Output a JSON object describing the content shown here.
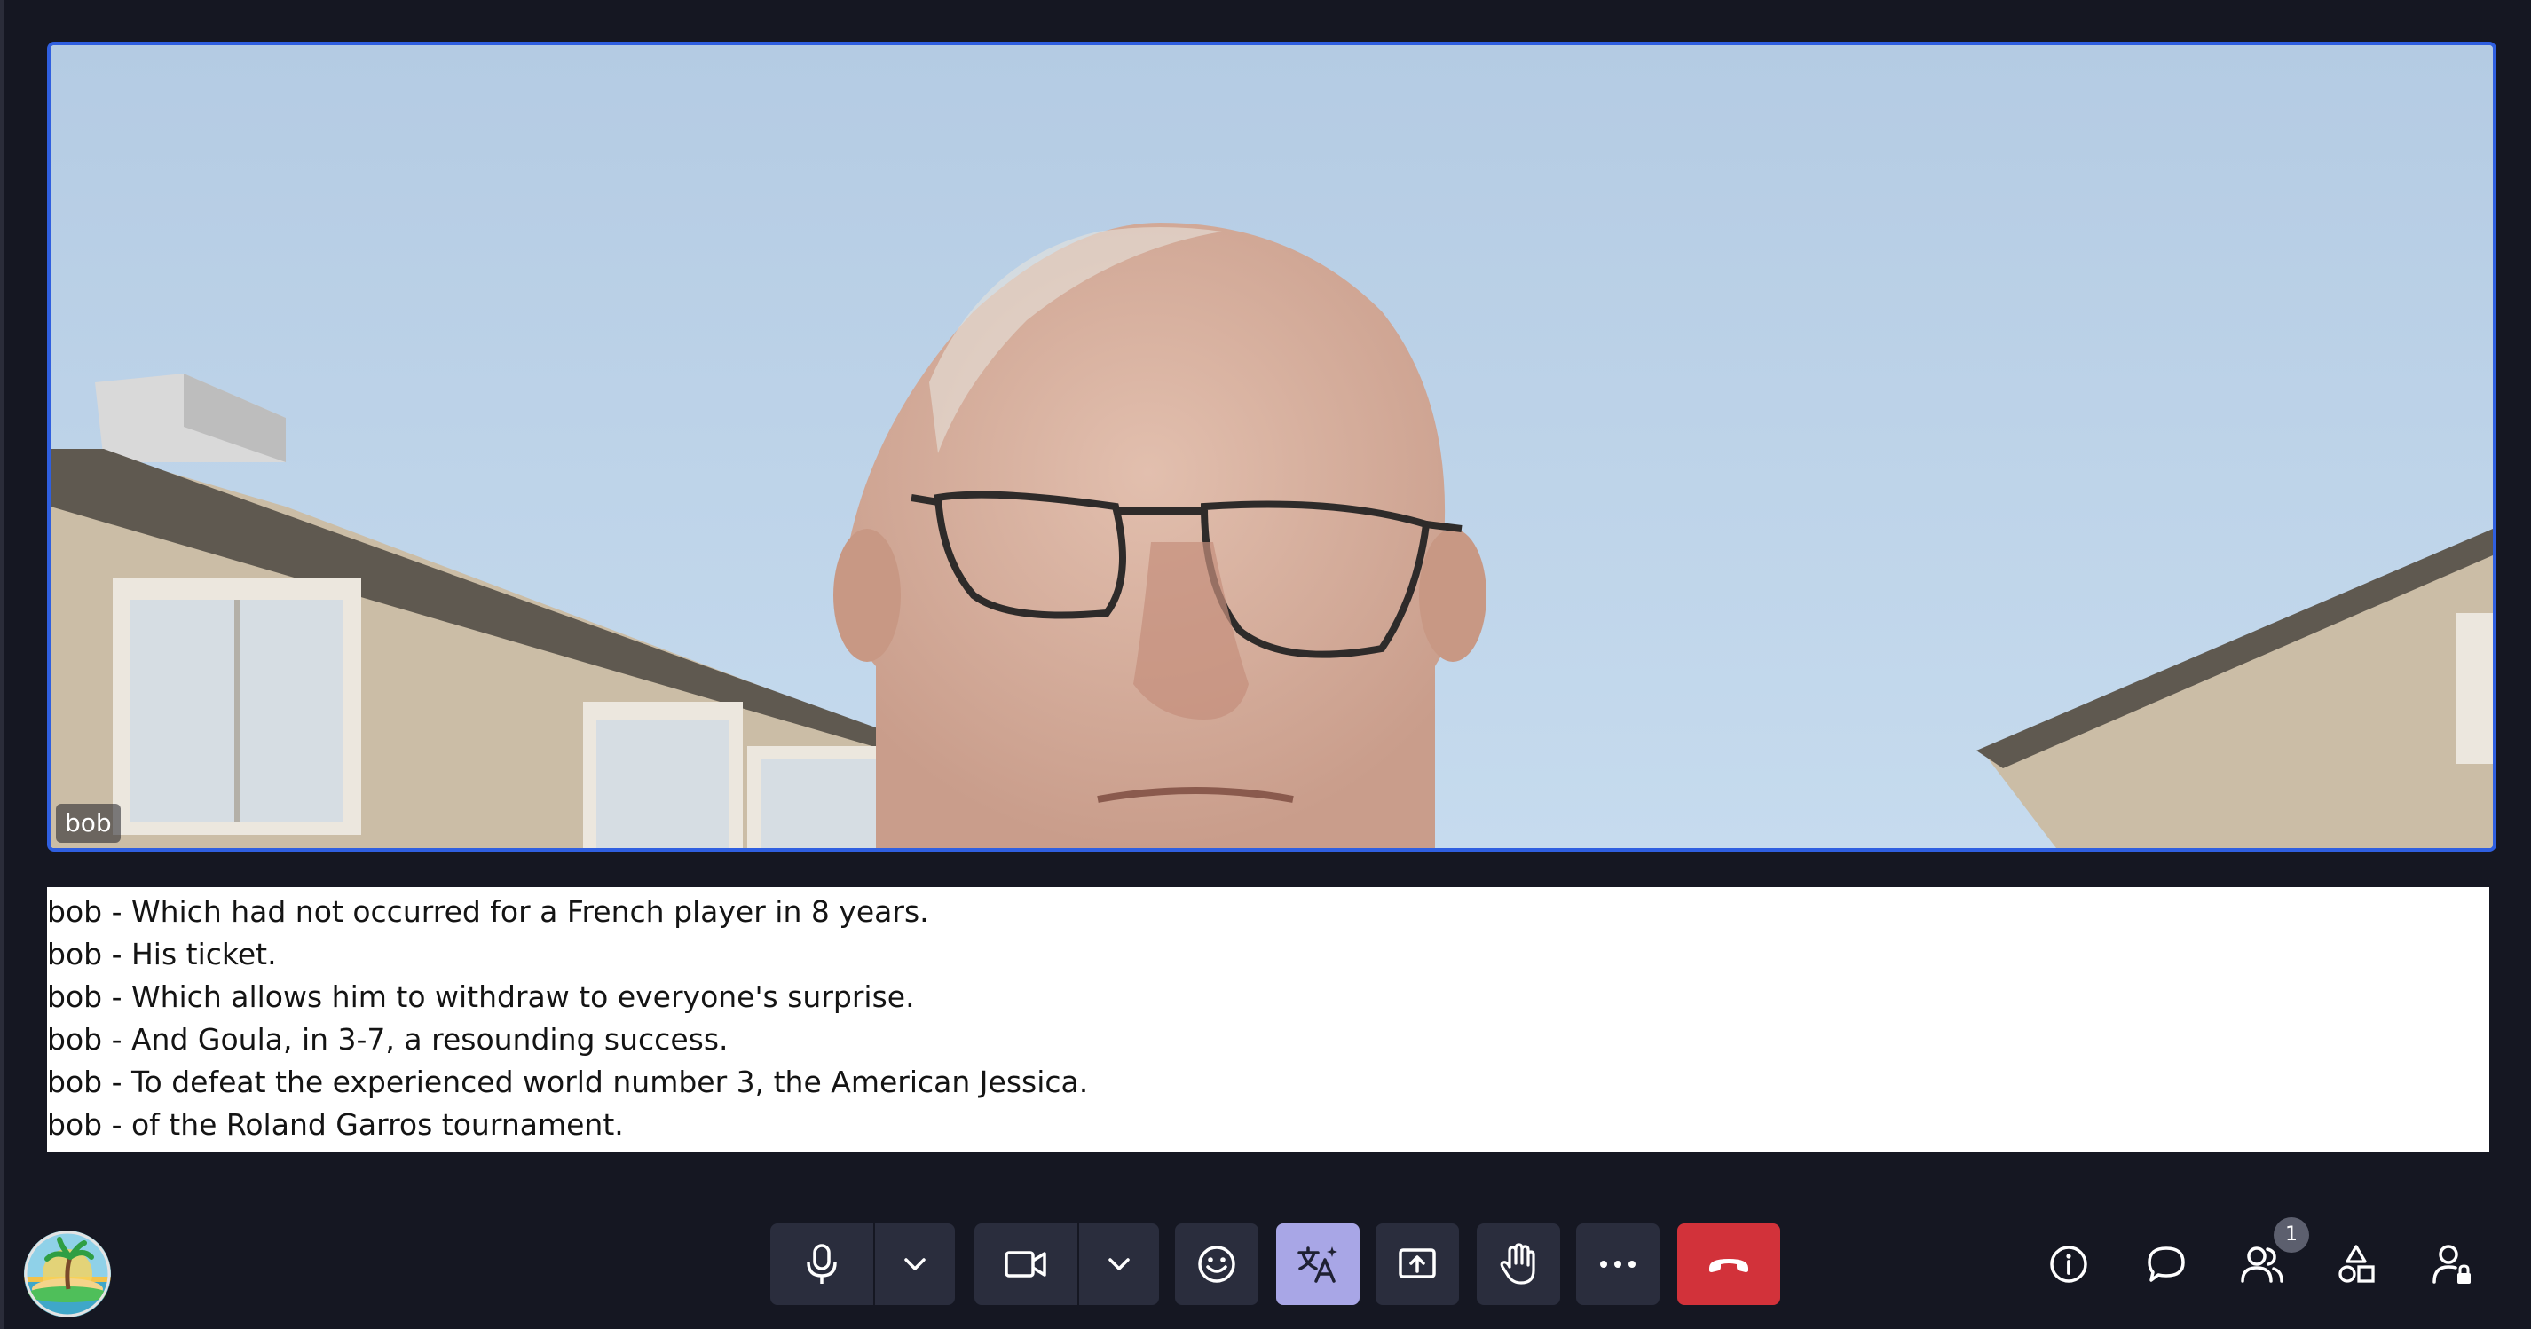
{
  "participant": {
    "name_tag": "bob"
  },
  "captions": [
    "bob - Which had not occurred for a French player in 8 years.",
    "bob - His ticket.",
    "bob - Which allows him to withdraw to everyone's surprise.",
    "bob - And Goula, in 3-7, a resounding success.",
    "bob - To defeat the experienced world number 3, the American Jessica.",
    "bob - of the Roland Garros tournament."
  ],
  "toolbar": {
    "buttons": [
      {
        "name": "microphone",
        "icon": "microphone-icon"
      },
      {
        "name": "microphone-options",
        "icon": "chevron-down-icon"
      },
      {
        "name": "camera",
        "icon": "video-camera-icon"
      },
      {
        "name": "camera-options",
        "icon": "chevron-down-icon"
      },
      {
        "name": "reactions",
        "icon": "smiley-icon"
      },
      {
        "name": "translation",
        "icon": "translate-icon",
        "active": true
      },
      {
        "name": "share-screen",
        "icon": "share-screen-icon"
      },
      {
        "name": "raise-hand",
        "icon": "hand-icon"
      },
      {
        "name": "more",
        "icon": "more-icon"
      },
      {
        "name": "hang-up",
        "icon": "phone-hangup-icon"
      }
    ],
    "right": [
      {
        "name": "info",
        "icon": "info-icon"
      },
      {
        "name": "chat",
        "icon": "chat-bubble-icon"
      },
      {
        "name": "participants",
        "icon": "people-icon",
        "badge": "1"
      },
      {
        "name": "tools",
        "icon": "shapes-icon"
      },
      {
        "name": "admin",
        "icon": "user-lock-icon"
      }
    ],
    "participants_count": "1"
  },
  "colors": {
    "background": "#151722",
    "button": "#2a2d3d",
    "active_button": "#a8a6e6",
    "hangup": "#d2323a",
    "tile_border": "#2f5fe0"
  }
}
